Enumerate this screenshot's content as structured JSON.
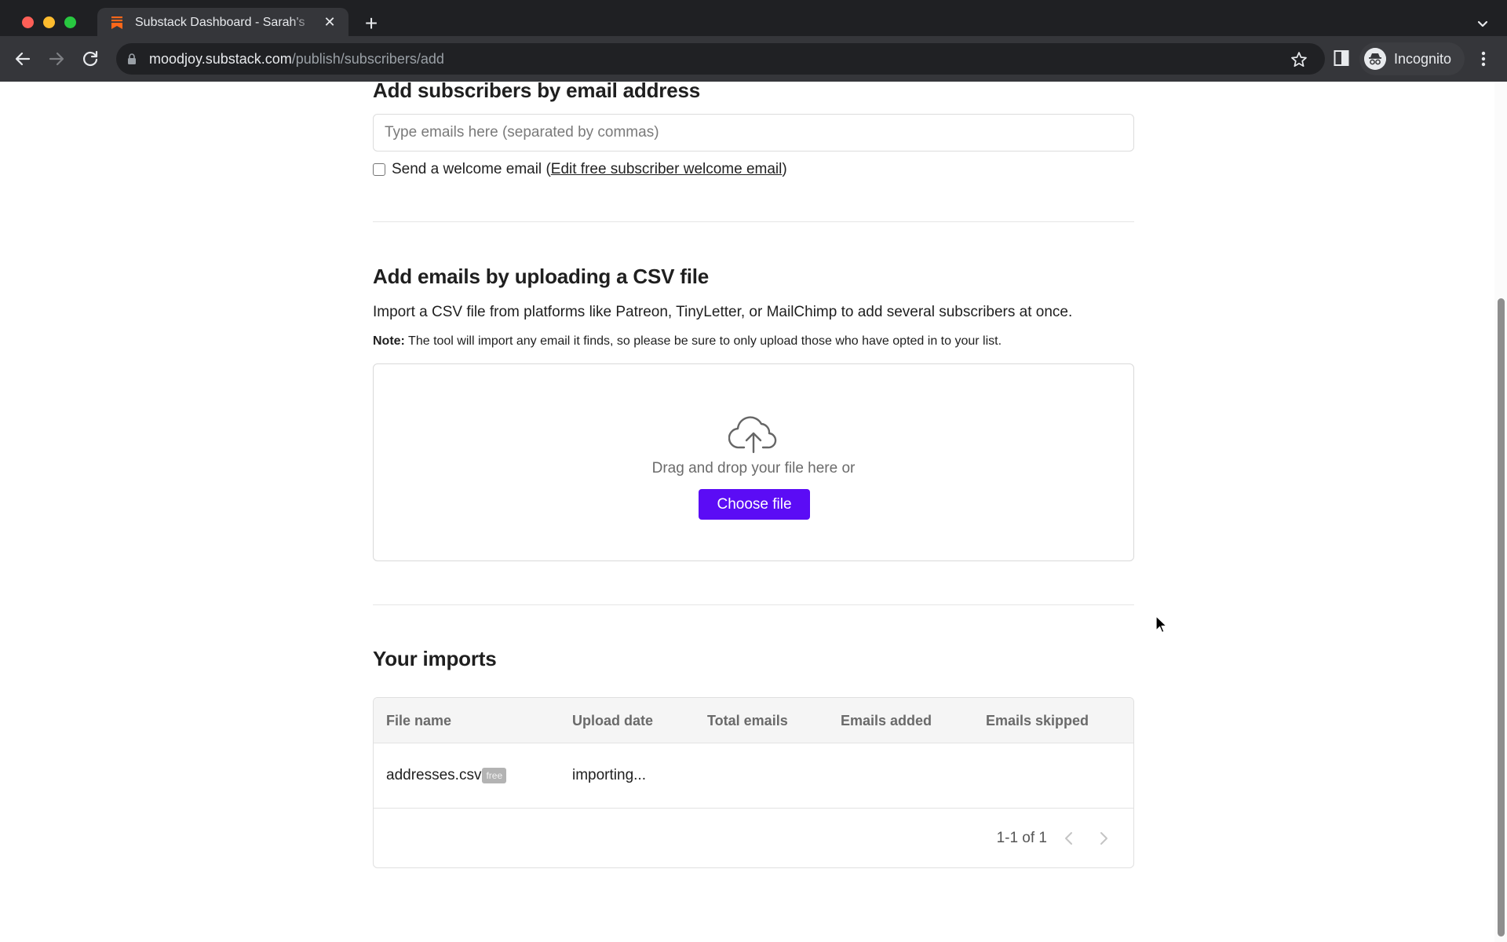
{
  "browser": {
    "tab": {
      "title": "Substack Dashboard - Sarah's",
      "favicon": "substack-logo-icon",
      "brand_color": "#ff6719"
    },
    "new_tab_label": "+",
    "url": {
      "host": "moodjoy.substack.com",
      "path": "/publish/subscribers/add"
    },
    "profile_label": "Incognito",
    "icons": [
      "back-icon",
      "forward-icon",
      "reload-icon",
      "lock-icon",
      "star-icon",
      "side-panel-icon",
      "incognito-icon",
      "more-menu-icon",
      "tab-search-icon"
    ]
  },
  "email_section": {
    "heading": "Add subscribers by email address",
    "input_placeholder": "Type emails here (separated by commas)",
    "input_value": "",
    "welcome_checkbox_checked": false,
    "welcome_label": "Send a welcome email",
    "welcome_link_prefix": "(",
    "welcome_link": "Edit free subscriber welcome email",
    "welcome_link_suffix": ")"
  },
  "csv_section": {
    "heading": "Add emails by uploading a CSV file",
    "description": "Import a CSV file from platforms like Patreon, TinyLetter, or MailChimp to add several subscribers at once.",
    "note_label": "Note:",
    "note_text": " The tool will import any email it finds, so please be sure to only upload those who have opted in to your list.",
    "upload_icon": "cloud-upload-icon",
    "drag_text": "Drag and drop your file here or",
    "choose_button": "Choose file",
    "accent_color": "#5b0cf5"
  },
  "imports": {
    "heading": "Your imports",
    "columns": [
      "File name",
      "Upload date",
      "Total emails",
      "Emails added",
      "Emails skipped"
    ],
    "rows": [
      {
        "file_name": "addresses.csv",
        "badge": "free",
        "upload_date": "importing...",
        "total_emails": "",
        "emails_added": "",
        "emails_skipped": ""
      }
    ],
    "pagination": "1-1 of 1"
  }
}
